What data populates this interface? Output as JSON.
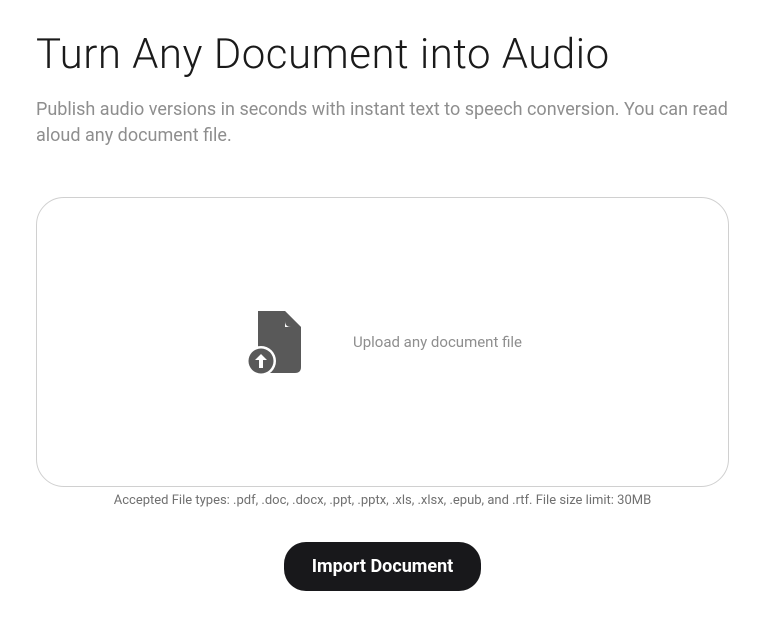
{
  "header": {
    "title": "Turn Any Document into Audio",
    "subtitle": "Publish audio versions in seconds with instant text to speech conversion. You can read aloud any document file."
  },
  "dropzone": {
    "label": "Upload any document file"
  },
  "accepted": {
    "text": "Accepted File types: .pdf, .doc, .docx, .ppt, .pptx, .xls, .xlsx, .epub, and .rtf. File size limit: 30MB"
  },
  "actions": {
    "import_label": "Import Document"
  }
}
